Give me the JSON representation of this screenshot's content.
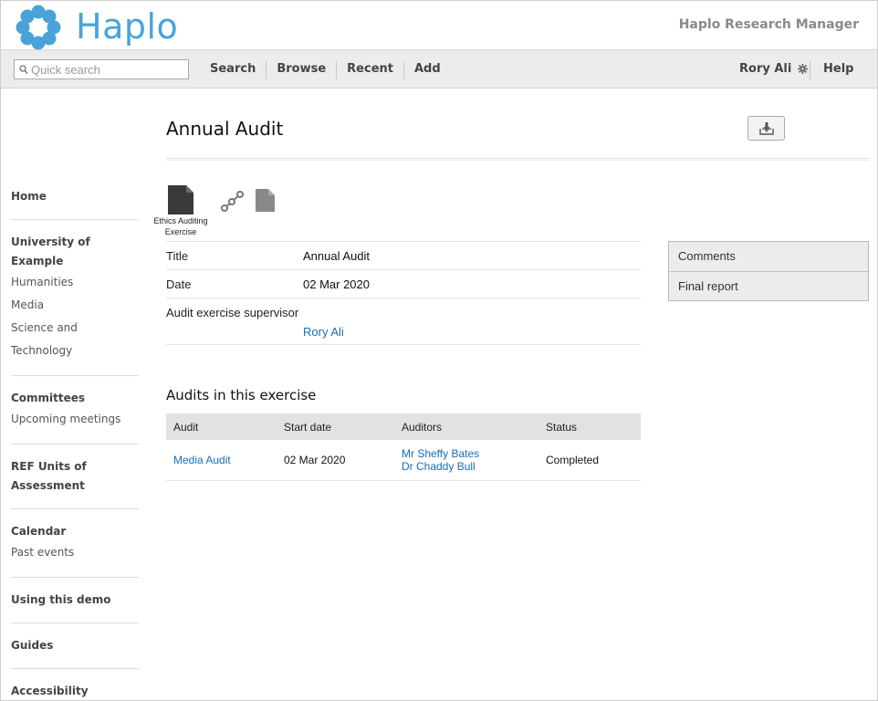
{
  "header": {
    "brand": "Haplo",
    "product": "Haplo Research Manager",
    "brand_color": "#4aa3d8"
  },
  "toolbar": {
    "search_placeholder": "Quick search",
    "nav": [
      "Search",
      "Browse",
      "Recent",
      "Add"
    ],
    "user": "Rory Ali",
    "help": "Help"
  },
  "sidebar": {
    "sections": [
      {
        "head": "Home",
        "links": []
      },
      {
        "head": "University of Example",
        "links": [
          "Humanities",
          "Media",
          "Science and Technology"
        ]
      },
      {
        "head": "Committees",
        "links": [
          "Upcoming meetings"
        ]
      },
      {
        "head": "REF Units of Assessment",
        "links": []
      },
      {
        "head": "Calendar",
        "links": [
          "Past events"
        ]
      },
      {
        "head": "Using this demo",
        "links": []
      },
      {
        "head": "Guides",
        "links": []
      },
      {
        "head": "Accessibility",
        "links": []
      }
    ]
  },
  "main": {
    "title": "Annual Audit",
    "type_label": "Ethics Auditing Exercise",
    "attributes": {
      "title_label": "Title",
      "title_value": "Annual Audit",
      "date_label": "Date",
      "date_value": "02 Mar 2020",
      "supervisor_label": "Audit exercise supervisor",
      "supervisor_value": "Rory Ali"
    },
    "side_panel": [
      "Comments",
      "Final report"
    ],
    "audits_title": "Audits in this exercise",
    "audits_table": {
      "headers": [
        "Audit",
        "Start date",
        "Auditors",
        "Status"
      ],
      "rows": [
        {
          "audit": "Media Audit",
          "start_date": "02 Mar 2020",
          "auditors": [
            "Mr Sheffy Bates",
            "Dr Chaddy Bull"
          ],
          "status": "Completed"
        }
      ]
    }
  }
}
